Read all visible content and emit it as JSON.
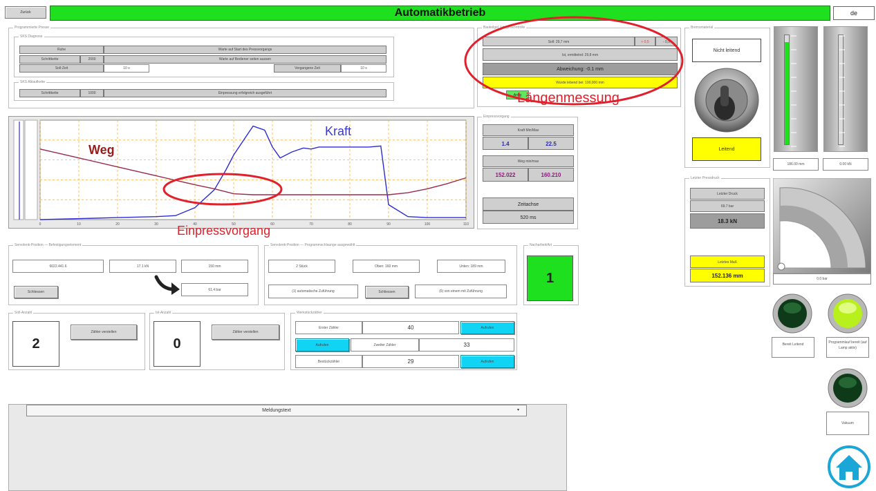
{
  "header": {
    "left_button": "Zurück",
    "title": "Automatikbetrieb",
    "language": "de"
  },
  "programmed_press": {
    "legend": "Programmierte Presse",
    "diag": {
      "legend": "SKS Diagnose",
      "label_row1": "Ruhe",
      "msg_row1": "Warte auf Start des Pressvorgangs",
      "label_row2": "Schrittkette",
      "num_row2": "2000",
      "msg_row2": "Warte auf Bediener seiten aussen",
      "label_row3": "Soll-Zeit",
      "val_row3": "10 s",
      "label_row3b": "Vergangene Zeit",
      "val_row3b": "10 s"
    },
    "seq": {
      "legend": "SKS Ablaufkette",
      "label": "Schrittkette",
      "num": "1000",
      "msg": "Einpressung erfolgreich ausgeführt"
    }
  },
  "length_check": {
    "legend": "Bauteilgel. Längenkontrolle",
    "row1": "Soll: 29,7 mm",
    "row1_btn1": "+ 0,5",
    "row1_btn2": "- 0,5",
    "row2": "Ist, ermittelnd: 29,8 mm",
    "deviation": "Abweichung: -0.1 mm",
    "measured": "Wurde lebend bei: 100,000 mm",
    "ok_label": "Antig"
  },
  "annotations": {
    "length": "Längenmessung",
    "press": "Einpressvorgang",
    "force": "Kraft",
    "way": "Weg"
  },
  "chart_data": {
    "type": "line",
    "title": "",
    "xlabel": "",
    "ylabel": "",
    "x_ticks": [
      "0",
      "10",
      "20",
      "30",
      "40",
      "50",
      "60",
      "70",
      "80",
      "90",
      "100",
      "110"
    ],
    "ylim": [
      0,
      1
    ],
    "series": [
      {
        "name": "Kraft",
        "color": "#2b2bd8",
        "x": [
          0,
          10,
          20,
          30,
          35,
          40,
          45,
          48,
          50,
          55,
          58,
          60,
          62,
          65,
          68,
          70,
          72,
          80,
          85,
          88,
          90,
          95,
          100,
          105,
          110
        ],
        "y": [
          0.0,
          0.01,
          0.02,
          0.03,
          0.04,
          0.12,
          0.3,
          0.5,
          0.65,
          0.94,
          0.9,
          0.73,
          0.62,
          0.68,
          0.72,
          0.71,
          0.73,
          0.73,
          0.73,
          0.74,
          0.15,
          0.03,
          0.02,
          0.02,
          0.02
        ]
      },
      {
        "name": "Weg",
        "color": "#9b2a4a",
        "x": [
          0,
          10,
          20,
          30,
          40,
          45,
          50,
          55,
          60,
          70,
          80,
          85,
          90,
          95,
          100,
          105,
          110
        ],
        "y": [
          0.71,
          0.62,
          0.53,
          0.44,
          0.35,
          0.31,
          0.26,
          0.25,
          0.25,
          0.25,
          0.25,
          0.25,
          0.25,
          0.27,
          0.31,
          0.36,
          0.42
        ]
      }
    ]
  },
  "press_sequence": {
    "legend": "Einpressvorgang",
    "force_label": "Kraft Min/Max",
    "force_min": "1.4",
    "force_max": "22.5",
    "way_label": "Weg min/max",
    "way_min": "152.022",
    "way_max": "160.210",
    "time_label": "Zeitachse",
    "time_value": "520 ms"
  },
  "position_panel": {
    "legend": "Servolenk-Position --- Befestigungselement",
    "v1": "6022.441.6",
    "v2": "17.1 kN",
    "v3": "150 mm",
    "v4": "61.4 bar",
    "button": "Schliessen"
  },
  "program_panel": {
    "legend": "Servolenk-Position --- Programmschlaunge ausgewählt",
    "v1": "2 Stück",
    "v2": "Oben: 160 mm",
    "v3": "Unten: 189 mm",
    "v4": "(1) automatische Zuführung",
    "button": "Schliessen",
    "v5": "(6) von einem mit Zuführung"
  },
  "rework": {
    "legend": "Nacharbeit/Art",
    "value": "1"
  },
  "target_count": {
    "legend": "Soll-Anzahl",
    "value": "2",
    "button": "Zähler verstellen"
  },
  "actual_count": {
    "legend": "Ist-Anzahl",
    "value": "0",
    "button": "Zähler verstellen"
  },
  "counters": {
    "legend": "Werkstückzähler",
    "row1_label": "Erster Zähler",
    "row1_value": "40",
    "row1_btn": "Aufrufen",
    "row2_btn": "Aufrufen",
    "row2_label": "Zweiter Zähler",
    "row2_value": "33",
    "row3_label": "Bestückzähler",
    "row3_value": "29",
    "row3_btn": "Aufrufen"
  },
  "messages": {
    "header": "Meldungstext"
  },
  "brake": {
    "legend": "Bremsmaterial",
    "top_label": "Nicht leitend",
    "bottom_label": "Leitend"
  },
  "bar_gauges": {
    "left_value": "186.00 mm",
    "right_value": "0.00 kN"
  },
  "last_press": {
    "legend": "Letzter Pressdruck",
    "pressure_label": "Letzter Druck",
    "pressure_value": "69.7 bar",
    "force_value": "18.3 kN",
    "measure_label": "Letztes Maß",
    "measure_value": "152.136 mm"
  },
  "round_gauge": {
    "value": "0.0 bar"
  },
  "lamps": {
    "lamp1_label": "Bereit Leitend",
    "lamp2_label": "Programmlauf bereit (auf Lamp aktiv)",
    "lamp3_label": "Vakuum"
  },
  "colors": {
    "accent_green": "#1ee01e",
    "cyan": "#11d4f5",
    "yellow": "#ffff00",
    "annotation_red": "#e0202a"
  }
}
